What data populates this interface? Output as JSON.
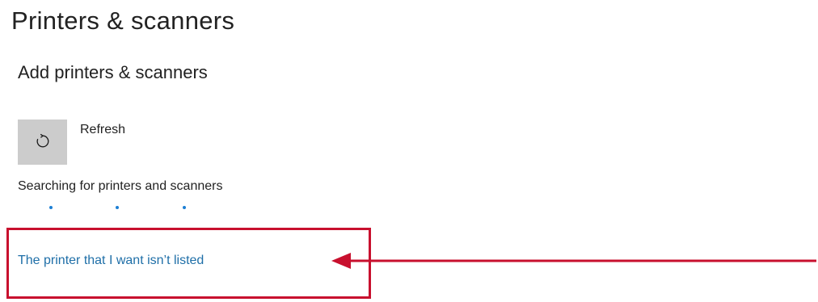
{
  "page": {
    "title": "Printers & scanners"
  },
  "add_section": {
    "title": "Add printers & scanners",
    "refresh_label": "Refresh",
    "refresh_icon": "refresh-icon",
    "status_text": "Searching for printers and scanners",
    "progress_dots_count": 3,
    "progress_color": "#1c7fd4"
  },
  "links": {
    "printer_not_listed": "The printer that I want isn’t listed"
  },
  "annotation": {
    "highlight_color": "#c8102e",
    "arrow_color": "#c8102e"
  }
}
